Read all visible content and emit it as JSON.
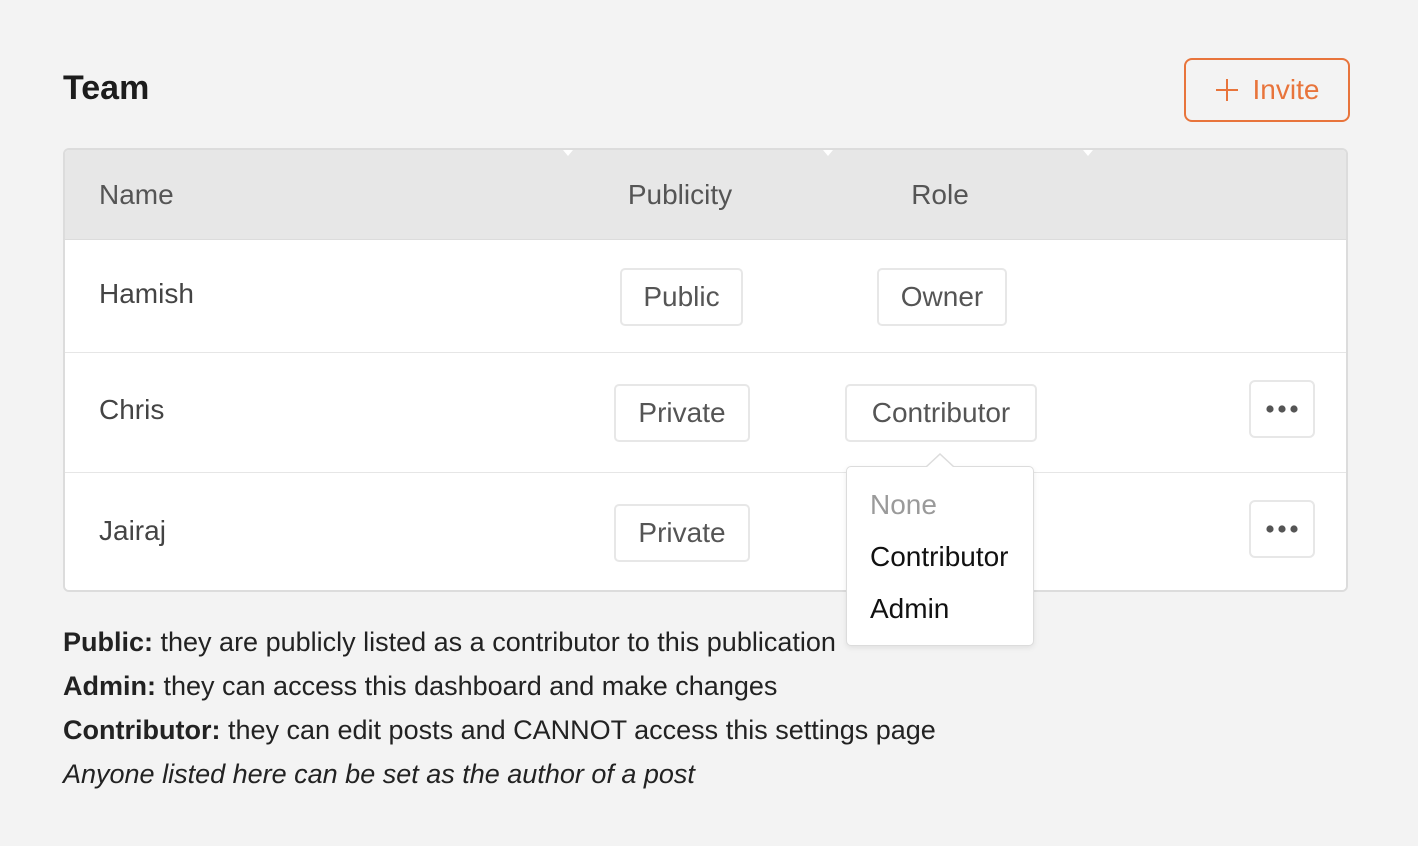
{
  "header": {
    "title": "Team",
    "invite_label": "Invite"
  },
  "colors": {
    "accent": "#e8743b",
    "background": "#f3f3f3",
    "header_bg": "#e7e7e7"
  },
  "table": {
    "columns": [
      "Name",
      "Publicity",
      "Role"
    ],
    "rows": [
      {
        "name": "Hamish",
        "publicity": "Public",
        "role": "Owner",
        "has_menu": false
      },
      {
        "name": "Chris",
        "publicity": "Private",
        "role": "Contributor",
        "has_menu": true
      },
      {
        "name": "Jairaj",
        "publicity": "Private",
        "role": "",
        "has_menu": true
      }
    ]
  },
  "role_dropdown": {
    "open": true,
    "options": [
      {
        "label": "None",
        "disabled": true
      },
      {
        "label": "Contributor",
        "disabled": false
      },
      {
        "label": "Admin",
        "disabled": false
      }
    ]
  },
  "legend": {
    "public_term": "Public:",
    "public_desc": " they are publicly listed as a contributor to this publication",
    "admin_term": "Admin:",
    "admin_desc": " they can access this dashboard and make changes",
    "contributor_term": "Contributor:",
    "contributor_desc": " they can edit posts and CANNOT access this settings page",
    "note": "Anyone listed here can be set as the author of a post"
  },
  "icons": {
    "invite": "plus-icon",
    "row_menu": "more-horizontal-icon"
  }
}
